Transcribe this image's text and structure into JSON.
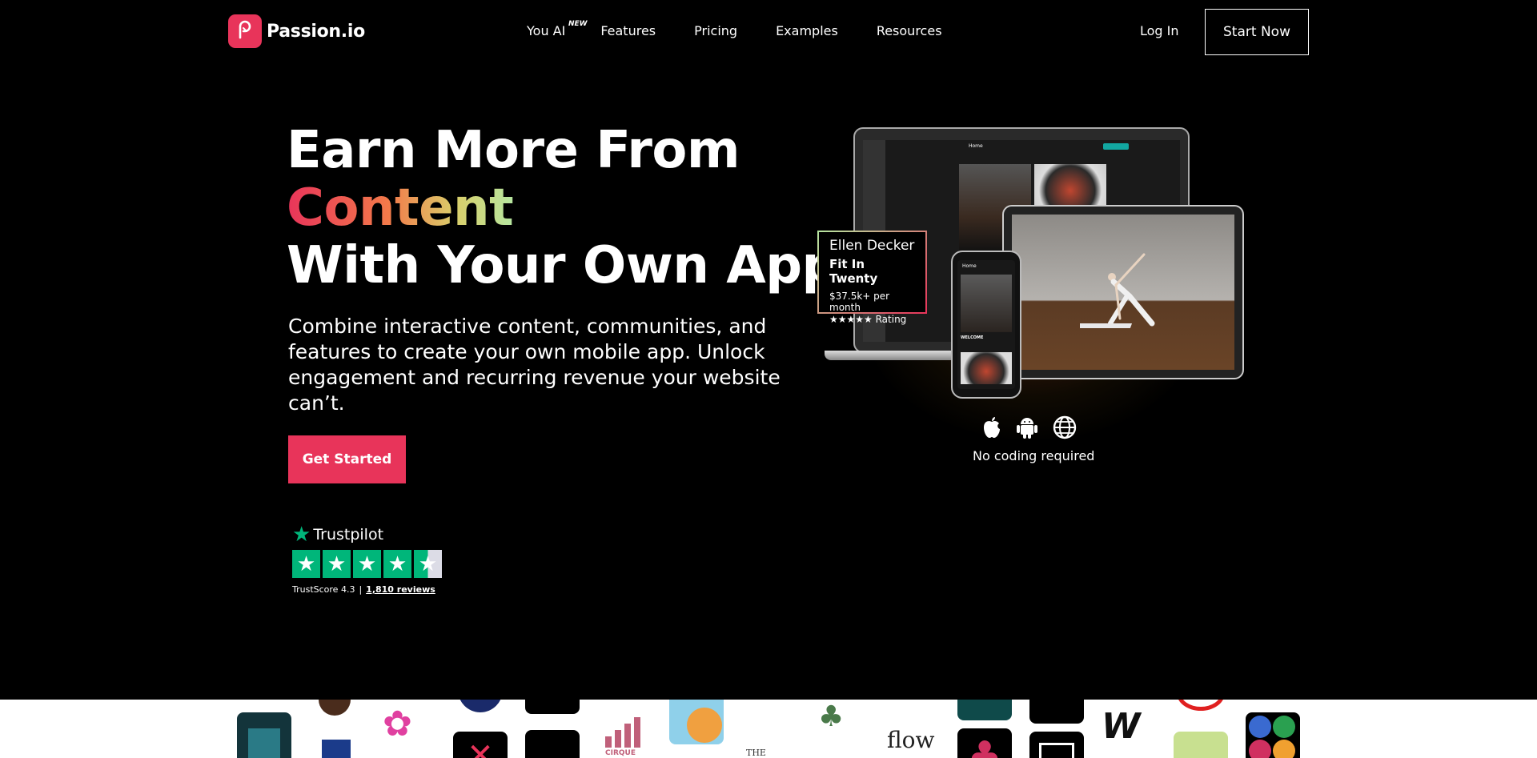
{
  "nav": {
    "brand": "Passion.io",
    "links": [
      {
        "label": "You AI",
        "badge": "NEW"
      },
      {
        "label": "Features"
      },
      {
        "label": "Pricing"
      },
      {
        "label": "Examples"
      },
      {
        "label": "Resources"
      }
    ],
    "login": "Log In",
    "cta": "Start Now"
  },
  "hero": {
    "title_line1": "Earn More From",
    "title_line2": "Content",
    "title_line3": "With Your Own App",
    "subtitle": "Combine interactive content, communities, and features to create your own mobile app. Unlock engagement and recurring revenue your website can’t.",
    "cta": "Get Started"
  },
  "trustpilot": {
    "brand": "Trustpilot",
    "score_label": "TrustScore 4.3",
    "separator": "|",
    "reviews": "1,810 reviews",
    "rating": 4.3
  },
  "showcase": {
    "card_name": "Ellen Decker",
    "card_app": "Fit In Twenty",
    "card_price": "$37.5k+ per month",
    "card_rating": "★★★★★ Rating",
    "laptop_home": "Home",
    "phone_home": "Home",
    "phone_welcome": "WELCOME",
    "platform_icons": [
      "apple-icon",
      "android-icon",
      "globe-icon"
    ],
    "no_coding": "No coding required"
  },
  "logo_strip": {
    "visible_text": [
      "flow",
      "THE",
      "CIRQUE"
    ]
  },
  "colors": {
    "accent": "#e8345a",
    "trustpilot_green": "#00b67a",
    "background": "#000000"
  }
}
